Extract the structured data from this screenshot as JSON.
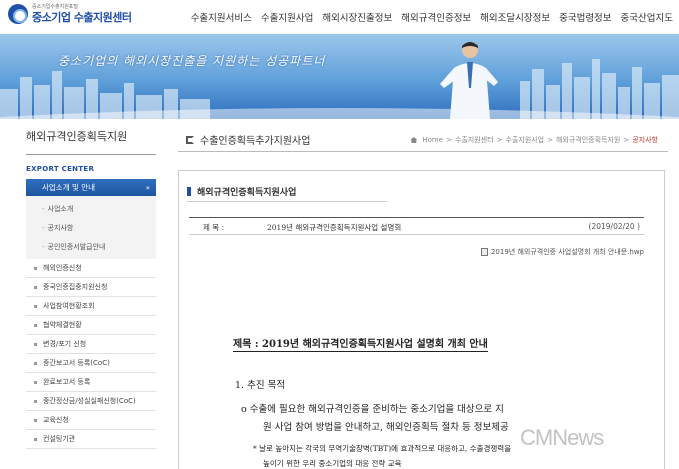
{
  "header": {
    "logo_sub": "중소기업수출지원포털",
    "logo_main": "중소기업 수출지원센터",
    "nav": [
      "수출지원서비스",
      "수출지원사업",
      "해외시장진출정보",
      "해외규격인증정보",
      "해외조달시장정보",
      "중국법령정보",
      "중국산업지도"
    ]
  },
  "banner": {
    "slogan": "중소기업의 해외시장진출을 지원하는 성공파트너"
  },
  "sidebar": {
    "title": "해외규격인증획득지원",
    "subtitle": "EXPORT CENTER",
    "active": {
      "label": "사업소개 및 안내",
      "arrow": "»"
    },
    "sub_items": [
      {
        "label": "사업소개"
      },
      {
        "label": "공지사항"
      },
      {
        "label": "공인인증서발급안내"
      }
    ],
    "items": [
      {
        "label": "해외인증신청"
      },
      {
        "label": "중국인증집중지원신청"
      },
      {
        "label": "사업참여현황조회"
      },
      {
        "label": "협약체결현황"
      },
      {
        "label": "변경/포기 신청"
      },
      {
        "label": "중간보고서 등록(CoC)"
      },
      {
        "label": "완료보고서 등록"
      },
      {
        "label": "중간정산금/성실실패신청(CoC)"
      },
      {
        "label": "교육신청"
      },
      {
        "label": "컨설팅기관"
      }
    ]
  },
  "main": {
    "title": "수출인증획득추가지원사업",
    "breadcrumb": {
      "home": "Home",
      "items": [
        "수출지원센터",
        "수출지원사업",
        "해외규격인증획득지원"
      ],
      "current": "공지사항"
    },
    "section_title": "해외규격인증획득지원사업",
    "post": {
      "label": "제      목 :",
      "subject": "2019년 해외규격인증획득지원사업 설명회",
      "date": "(2019/02/20 )",
      "attachment": "2019년 해외규격인증 사업설명회 개최 안내문.hwp"
    },
    "document": {
      "title": "제목 : 2019년 해외규격인증획득지원사업 설명회 개최 안내",
      "heading1": "1. 추진 목적",
      "para1": "o  수출에 필요한 해외규격인증을 준비하는 중소기업을 대상으로 지",
      "para2": "원 사업 참여 방법을 안내하고, 해외인증획득 절차 등 정보제공",
      "note1": "* 날로 높아지는 각국의 무역기술장벽(TBT)에 효과적으로 대응하고, 수출경쟁력을",
      "note2": "높이기 위한 우리 중소기업의 대응 전략 교육"
    }
  },
  "watermark": "CMNews",
  "colors": {
    "brand": "#1f4fa8",
    "active_menu": "#2f6fbf",
    "breadcrumb_current": "#c0392b"
  }
}
